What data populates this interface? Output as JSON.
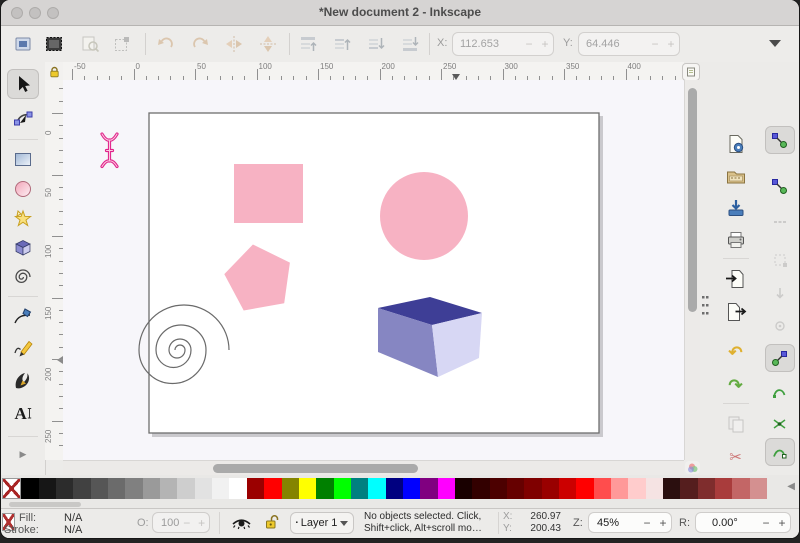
{
  "window": {
    "title": "*New document 2 - Inkscape"
  },
  "ui": {
    "minus": "−",
    "plus": "+",
    "expander": "▶",
    "dropdown_caret": "▼",
    "undo_glyph": "↶",
    "redo_glyph": "↷",
    "cut_glyph": "✂",
    "palette_prev": "◀",
    "text_tool_glyph": "A",
    "layer_bullet": "▪"
  },
  "toolbar": {
    "x_label": "X:",
    "x_value": "112.653",
    "y_label": "Y:",
    "y_value": "64.446",
    "icons": [
      "selection-frame",
      "select-all",
      "select-all-in-all-layers",
      "deselect",
      "rotate-90-ccw",
      "rotate-90-cw",
      "flip-horizontal",
      "flip-vertical",
      "raise-to-top",
      "raise",
      "lower",
      "lower-to-bottom",
      "toolbar-overflow"
    ]
  },
  "left_toolbox": {
    "tools": [
      "selector-tool",
      "node-tool",
      "rectangle-tool",
      "ellipse-tool",
      "star-tool",
      "box3d-tool",
      "spiral-tool",
      "pen-tool",
      "pencil-tool",
      "calligraphy-tool",
      "text-tool"
    ],
    "selected": "selector-tool"
  },
  "rulers": {
    "h_labels": [
      "-50",
      "0",
      "50",
      "100",
      "150",
      "200",
      "250",
      "300",
      "350",
      "400"
    ],
    "v_labels": [
      "0",
      "50",
      "100",
      "150",
      "200",
      "250"
    ]
  },
  "commands_bar": [
    "document-properties",
    "open",
    "save",
    "print",
    "import",
    "export",
    "undo",
    "redo",
    "copy",
    "cut"
  ],
  "snap_bar": [
    "enable-snapping",
    "snap-bounding-box",
    "snap-bbox-edges",
    "snap-bbox-corners",
    "snap-bbox-midpoints",
    "snap-bbox-centers",
    "snap-nodes",
    "snap-to-paths",
    "snap-to-path-intersections",
    "snap-to-cusp-nodes",
    "snap-to-smooth-nodes"
  ],
  "canvas": {
    "cursor": "text-ibeam-cursor",
    "page": {
      "fill": "#ffffff",
      "border": "#6e6e6e"
    },
    "shapes": [
      {
        "type": "square",
        "fill": "#f7b2c3"
      },
      {
        "type": "circle",
        "fill": "#f7b2c3"
      },
      {
        "type": "pentagon",
        "fill": "#f7b2c3"
      },
      {
        "type": "spiral",
        "stroke": "#6a6a6a"
      },
      {
        "type": "box3d",
        "top": "#3e3e96",
        "front": "#8686c2",
        "side": "#d7d7f4"
      }
    ]
  },
  "palette": {
    "swatches": [
      "none",
      "#000000",
      "#161616",
      "#2c2c2c",
      "#414141",
      "#565656",
      "#6b6b6b",
      "#808080",
      "#9a9a9a",
      "#b4b4b4",
      "#cecece",
      "#e2e2e2",
      "#f1f1f1",
      "#ffffff",
      "#9b0000",
      "#ff0000",
      "#848400",
      "#ffff00",
      "#008000",
      "#00ff00",
      "#008080",
      "#00ffff",
      "#000080",
      "#0000ff",
      "#800080",
      "#ff00ff",
      "#190000",
      "#330000",
      "#4c0000",
      "#660000",
      "#7f0000",
      "#990000",
      "#cc0000",
      "#ff0000",
      "#ff4d4d",
      "#ff9999",
      "#ffcccc",
      "#f5e3e3",
      "#2b0f0f",
      "#551e1e",
      "#7f2d2d",
      "#a93c3c",
      "#c36666",
      "#d49090"
    ]
  },
  "status": {
    "fill_label": "Fill:",
    "fill_value": "N/A",
    "stroke_label": "Stroke:",
    "stroke_value": "N/A",
    "opacity_label": "O:",
    "opacity_value": "100",
    "layer_label": "Layer 1",
    "message_line1": "No objects selected. Click,",
    "message_line2": "Shift+click, Alt+scroll mo…",
    "x_label": "X:",
    "x_value": "260.97",
    "y_label": "Y:",
    "y_value": "200.43",
    "zoom_label": "Z:",
    "zoom_value": "45%",
    "rotation_label": "R:",
    "rotation_value": "0.00°"
  }
}
